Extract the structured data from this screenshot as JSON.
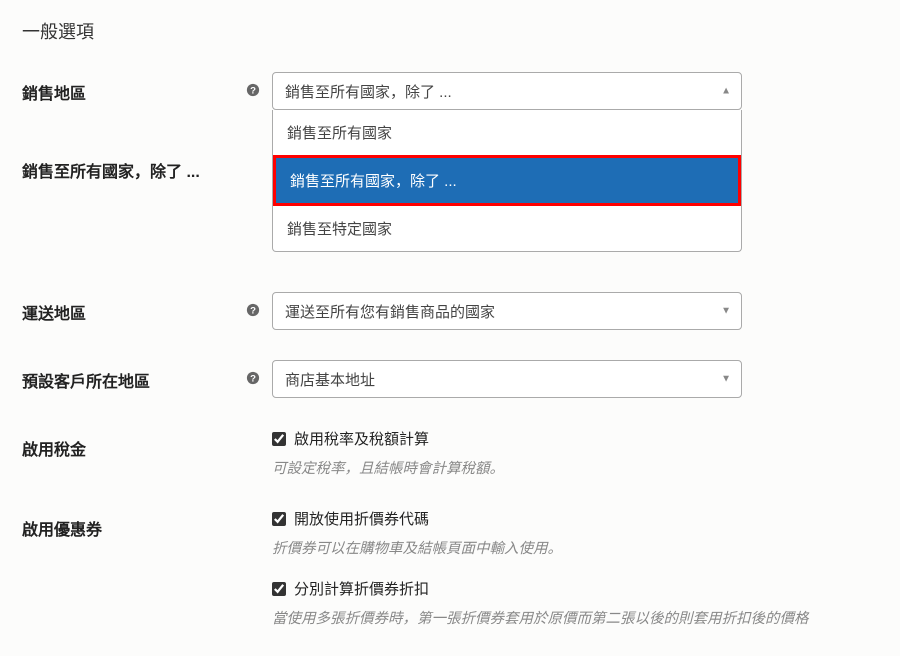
{
  "section_title": "一般選項",
  "rows": {
    "selling_region": {
      "label": "銷售地區",
      "selected": "銷售至所有國家，除了 ...",
      "options": {
        "opt0": "銷售至所有國家",
        "opt1": "銷售至所有國家，除了 ...",
        "opt2": "銷售至特定國家"
      }
    },
    "sell_except": {
      "label": "銷售至所有國家，除了 ..."
    },
    "shipping_region": {
      "label": "運送地區",
      "selected": "運送至所有您有銷售商品的國家"
    },
    "default_customer_location": {
      "label": "預設客戶所在地區",
      "selected": "商店基本地址"
    },
    "enable_tax": {
      "label": "啟用稅金",
      "checkbox_label": "啟用稅率及稅額計算",
      "help": "可設定稅率，且結帳時會計算稅額。"
    },
    "enable_coupon": {
      "label": "啟用優惠券",
      "cb1_label": "開放使用折價券代碼",
      "cb1_help": "折價券可以在購物車及結帳頁面中輸入使用。",
      "cb2_label": "分別計算折價券折扣",
      "cb2_help": "當使用多張折價券時，第一張折價券套用於原價而第二張以後的則套用折扣後的價格"
    }
  }
}
